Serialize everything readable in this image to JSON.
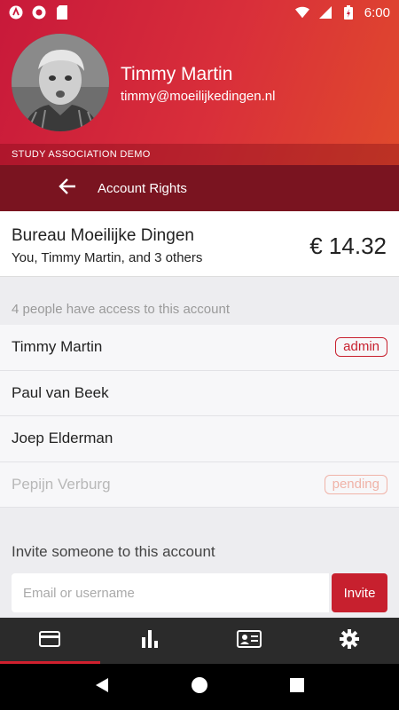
{
  "status_bar": {
    "time": "6:00",
    "icons": [
      "app-a-icon",
      "circle-icon",
      "sd-card-icon",
      "wifi-icon",
      "signal-icon",
      "battery-charging-icon"
    ]
  },
  "header": {
    "user_name": "Timmy Martin",
    "user_email": "timmy@moeilijkedingen.nl",
    "association": "STUDY ASSOCIATION DEMO"
  },
  "toolbar": {
    "title": "Account Rights"
  },
  "account": {
    "name": "Bureau Moeilijke Dingen",
    "members": "You, Timmy Martin, and 3 others",
    "balance": "€ 14.32"
  },
  "access": {
    "label": "4 people have access to this account",
    "people": [
      {
        "name": "Timmy Martin",
        "badge": "admin"
      },
      {
        "name": "Paul van Beek",
        "badge": ""
      },
      {
        "name": "Joep Elderman",
        "badge": ""
      },
      {
        "name": "Pepijn Verburg",
        "badge": "pending"
      }
    ]
  },
  "invite": {
    "label": "Invite someone to this account",
    "placeholder": "Email or username",
    "value": "",
    "button_label": "Invite"
  },
  "bottom_nav": {
    "items": [
      "card-icon",
      "bar-chart-icon",
      "contact-card-icon",
      "settings-icon"
    ],
    "active": 0
  },
  "colors": {
    "primary": "#c7202e",
    "toolbar": "#7a1420",
    "header_gradient_start": "#c8193a",
    "header_gradient_end": "#e04a2c",
    "pending": "#f0b3a8"
  }
}
